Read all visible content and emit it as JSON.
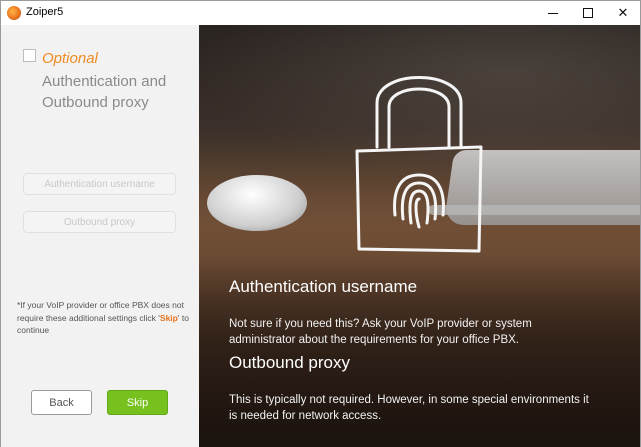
{
  "window": {
    "title": "Zoiper5",
    "controls": {
      "minimize": "minimize",
      "maximize": "maximize",
      "close": "✕"
    }
  },
  "left": {
    "optional_label": "Optional",
    "step_title": "Authentication and Outbound proxy",
    "fields": {
      "auth_username_placeholder": "Authentication username",
      "outbound_proxy_placeholder": "Outbound proxy"
    },
    "note": {
      "before": "*If your VoIP provider or office PBX does not require these additional settings click '",
      "skip_word": "Skip",
      "after": "' to continue"
    },
    "buttons": {
      "back": "Back",
      "skip": "Skip"
    }
  },
  "right": {
    "auth_heading": "Authentication username",
    "auth_text": "Not sure if you need this? Ask your VoIP provider or system administrator about the requirements for your office PBX.",
    "proxy_heading": "Outbound proxy",
    "proxy_text": "This is typically not required. However, in some special environments it is needed for network access."
  },
  "colors": {
    "accent_orange": "#f08a24",
    "skip_green": "#77c11e",
    "left_panel_bg": "#f2f2f2"
  },
  "icons": [
    "app-logo-icon",
    "padlock-fingerprint-icon"
  ]
}
